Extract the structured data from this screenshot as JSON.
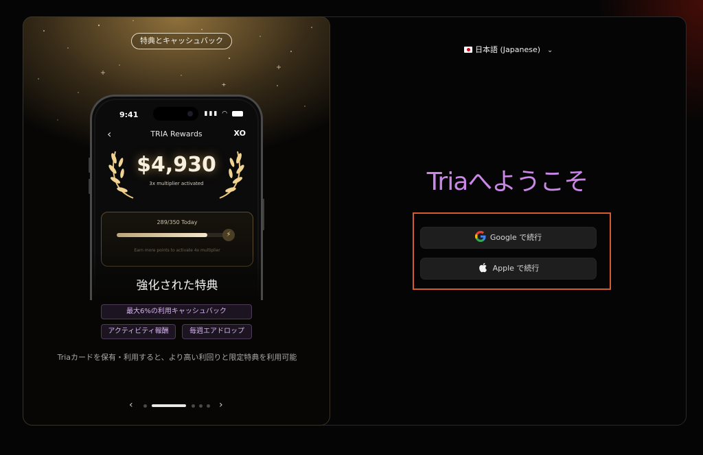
{
  "promo": {
    "pill_label": "特典とキャッシュバック",
    "phone": {
      "time": "9:41",
      "app_title": "TRIA Rewards",
      "logo_text": "XO",
      "amount": "$4,930",
      "multiplier": "3x multiplier activated",
      "progress_text": "289/350 Today",
      "progress_fraction": 0.826,
      "progress_note": "Earn more points to activate 4x multiplier"
    },
    "heading": "強化された特典",
    "tags": [
      "最大6%の利用キャッシュバック",
      "アクティビティ報酬",
      "毎週エアドロップ"
    ],
    "description": "Triaカードを保有・利用すると、より高い利回りと限定特典を利用可能",
    "pager": {
      "page_count": 5,
      "active_index": 1
    }
  },
  "language": {
    "label": "日本語 (Japanese)",
    "flag": "japan-flag-icon"
  },
  "welcome_title": "Triaへようこそ",
  "auth": {
    "google_label": "Google で続行",
    "apple_label": "Apple で続行"
  },
  "colors": {
    "accent_purple": "#c987e6",
    "highlight_box": "#d85a32",
    "button_bg": "#1e1e1e"
  }
}
